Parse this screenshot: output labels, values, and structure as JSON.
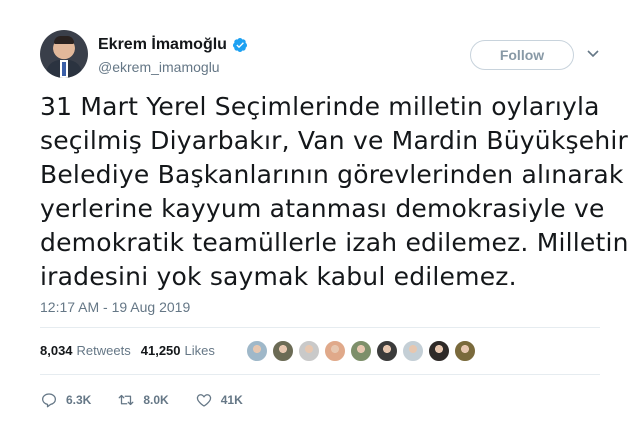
{
  "user": {
    "name": "Ekrem İmamoğlu",
    "handle": "@ekrem_imamoglu",
    "verified": true,
    "follow_label": "Follow"
  },
  "tweet": {
    "lines": [
      "31 Mart Yerel Seçimlerinde milletin oylarıyla",
      "seçilmiş Diyarbakır, Van ve Mardin Büyükşehir",
      "Belediye Başkanlarının görevlerinden alınarak",
      "yerlerine kayyum atanması demokrasiyle ve",
      "demokratik teamüllerle izah edilemez. Milletin",
      "iradesini yok saymak kabul edilemez."
    ],
    "timestamp": "12:17 AM - 19 Aug 2019"
  },
  "stats": {
    "retweets_count": "8,034",
    "retweets_label": "Retweets",
    "likes_count": "41,250",
    "likes_label": "Likes"
  },
  "liker_faces": [
    "#9fb8c9",
    "#6b6b55",
    "#c9c9c9",
    "#e0a98a",
    "#7d8f6a",
    "#3b3b3b",
    "#c4cfd6",
    "#2e2a28",
    "#7a6a3c"
  ],
  "actions": {
    "replies": "6.3K",
    "retweets": "8.0K",
    "likes": "41K"
  },
  "colors": {
    "text": "#14171a",
    "muted": "#657786",
    "verified": "#1da1f2",
    "divider": "#e6ecf0"
  }
}
